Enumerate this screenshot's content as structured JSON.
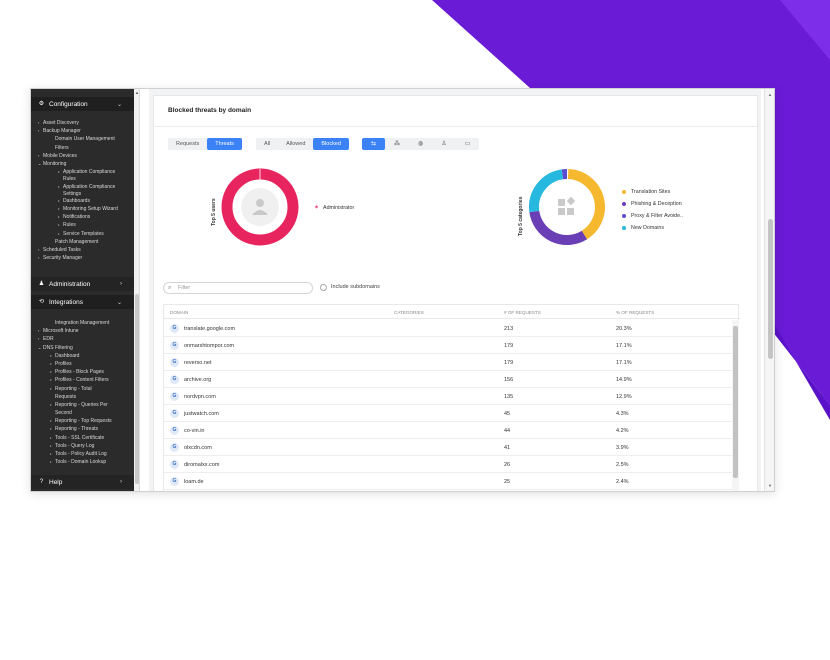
{
  "colors": {
    "accent": "#3b82f6",
    "purple_shape": "#6a1bd6",
    "users_donut": "#e8245f",
    "cat_translation": "#f5b82e",
    "cat_phishing": "#6a3fb5",
    "cat_proxy": "#5b4bd1",
    "cat_new_domains": "#27b8e0"
  },
  "sidebar": {
    "configuration": {
      "label": "Configuration",
      "items": [
        {
          "label": "Asset Discovery",
          "level": 1,
          "marker": "›"
        },
        {
          "label": "Backup Manager",
          "level": 1,
          "marker": "›"
        },
        {
          "label": "Domain User Management",
          "level": 2,
          "marker": ""
        },
        {
          "label": "Filters",
          "level": 2,
          "marker": ""
        },
        {
          "label": "Mobile Devices",
          "level": 1,
          "marker": "›"
        },
        {
          "label": "Monitoring",
          "level": 1,
          "marker": "⌄"
        },
        {
          "label": "Application Compliance",
          "level": 3,
          "marker": "•"
        },
        {
          "label": "Rules",
          "level": 3,
          "marker": ""
        },
        {
          "label": "Application Compliance",
          "level": 3,
          "marker": "•"
        },
        {
          "label": "Settings",
          "level": 3,
          "marker": ""
        },
        {
          "label": "Dashboards",
          "level": 3,
          "marker": "•"
        },
        {
          "label": "Monitoring Setup Wizard",
          "level": 3,
          "marker": "•"
        },
        {
          "label": "Notifications",
          "level": 3,
          "marker": "•"
        },
        {
          "label": "Rules",
          "level": 3,
          "marker": "•"
        },
        {
          "label": "Service Templates",
          "level": 3,
          "marker": "•"
        },
        {
          "label": "Patch Management",
          "level": 2,
          "marker": ""
        },
        {
          "label": "Scheduled Tasks",
          "level": 1,
          "marker": "›"
        },
        {
          "label": "Security Manager",
          "level": 1,
          "marker": "›"
        }
      ]
    },
    "administration": {
      "label": "Administration"
    },
    "integrations": {
      "label": "Integrations",
      "items": [
        {
          "label": "Integration Management",
          "level": 2,
          "marker": ""
        },
        {
          "label": "Microsoft Intune",
          "level": 1,
          "marker": "›"
        },
        {
          "label": "EDR",
          "level": 1,
          "marker": "›"
        },
        {
          "label": "DNS Filtering",
          "level": 1,
          "marker": "⌄"
        },
        {
          "label": "Dashboard",
          "level": 2,
          "marker": "•"
        },
        {
          "label": "Profiles",
          "level": 2,
          "marker": "•"
        },
        {
          "label": "Profiles - Block Pages",
          "level": 2,
          "marker": "•"
        },
        {
          "label": "Profiles - Content Filters",
          "level": 2,
          "marker": "•"
        },
        {
          "label": "Reporting - Total",
          "level": 2,
          "marker": "•"
        },
        {
          "label": "Requests",
          "level": 2,
          "marker": ""
        },
        {
          "label": "Reporting - Queries Per",
          "level": 2,
          "marker": "•"
        },
        {
          "label": "Second",
          "level": 2,
          "marker": ""
        },
        {
          "label": "Reporting - Top Requests",
          "level": 2,
          "marker": "•"
        },
        {
          "label": "Reporting - Threats",
          "level": 2,
          "marker": "•"
        },
        {
          "label": "Tools - SSL Certificate",
          "level": 2,
          "marker": "•"
        },
        {
          "label": "Tools - Query Log",
          "level": 2,
          "marker": "•"
        },
        {
          "label": "Tools - Policy Audit Log",
          "level": 2,
          "marker": "•"
        },
        {
          "label": "Tools - Domain Lookup",
          "level": 2,
          "marker": "•"
        }
      ]
    },
    "help": {
      "label": "Help"
    }
  },
  "card": {
    "title": "Blocked threats by domain",
    "toggle_a": [
      "Requests",
      "Threats"
    ],
    "toggle_b": [
      "All",
      "Allowed",
      "Blocked"
    ],
    "view_icons": [
      "domain-icon",
      "categories-icon",
      "globe-icon",
      "user-icon",
      "devices-icon"
    ]
  },
  "users_chart": {
    "label": "Top 5 users",
    "legend": [
      {
        "name": "Administrator",
        "color": "#e8245f"
      }
    ]
  },
  "categories_chart": {
    "label": "Top 5 categories",
    "legend": [
      {
        "name": "Translation Sites",
        "color": "#f5b82e"
      },
      {
        "name": "Phishing & Deception",
        "color": "#6a3fb5"
      },
      {
        "name": "Proxy & Filter Avoide..",
        "color": "#5b4bd1"
      },
      {
        "name": "New Domains",
        "color": "#27b8e0"
      }
    ]
  },
  "filter": {
    "placeholder": "Filter",
    "subdomains_label": "Include subdomains"
  },
  "table": {
    "headers": [
      "DOMAIN",
      "CATEGORIES",
      "# OF REQUESTS",
      "% OF REQUESTS"
    ],
    "rows": [
      {
        "domain": "translate.google.com",
        "requests": "213",
        "percent": "20.3%"
      },
      {
        "domain": "onmarshtompor.com",
        "requests": "179",
        "percent": "17.1%"
      },
      {
        "domain": "reverso.net",
        "requests": "179",
        "percent": "17.1%"
      },
      {
        "domain": "archive.org",
        "requests": "156",
        "percent": "14.9%"
      },
      {
        "domain": "nordvpn.com",
        "requests": "135",
        "percent": "12.9%"
      },
      {
        "domain": "justwatch.com",
        "requests": "45",
        "percent": "4.3%"
      },
      {
        "domain": "co-vin.in",
        "requests": "44",
        "percent": "4.2%"
      },
      {
        "domain": "olxcdn.com",
        "requests": "41",
        "percent": "3.9%"
      },
      {
        "domain": "diromalxx.com",
        "requests": "26",
        "percent": "2.5%"
      },
      {
        "domain": "loam.de",
        "requests": "25",
        "percent": "2.4%"
      }
    ]
  }
}
